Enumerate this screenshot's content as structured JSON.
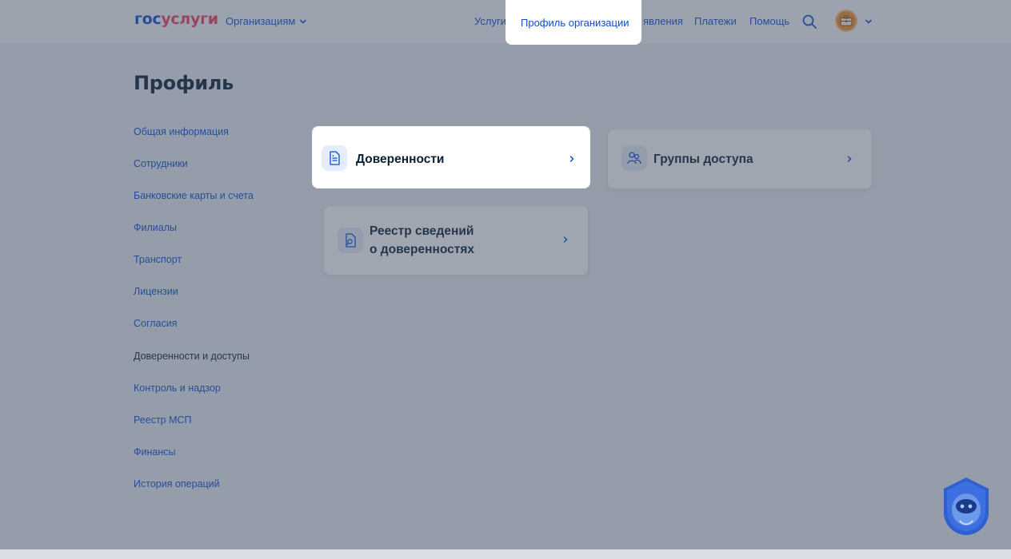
{
  "header": {
    "logo": {
      "part1": "гос",
      "part2": "услуги"
    },
    "org_menu_label": "Организациям",
    "nav": {
      "services": "Услуги",
      "org_profile": "Профиль организации",
      "statements": "явления",
      "payments": "Платежи",
      "help": "Помощь"
    }
  },
  "page": {
    "title": "Профиль",
    "sidebar": [
      "Общая информация",
      "Сотрудники",
      "Банковские карты и счета",
      "Филиалы",
      "Транспорт",
      "Лицензии",
      "Согласия",
      "Доверенности и доступы",
      "Контроль и надзор",
      "Реестр МСП",
      "Финансы",
      "История операций"
    ],
    "active_sidebar_item": "Доверенности и доступы",
    "cards": {
      "powers_of_attorney": "Доверенности",
      "access_groups": "Группы доступа",
      "registry_line1": "Реестр сведений",
      "registry_line2": "о доверенностях"
    }
  },
  "colors": {
    "brand_blue": "#0d4cd3",
    "brand_red": "#ee3f58",
    "text_dark": "#0b1f33",
    "avatar_orange": "#f08a24"
  },
  "icons": [
    "chevron-down-icon",
    "search-icon",
    "briefcase-icon",
    "document-icon",
    "people-icon",
    "search-document-icon",
    "chevron-right-icon",
    "assistant-robot-icon"
  ]
}
